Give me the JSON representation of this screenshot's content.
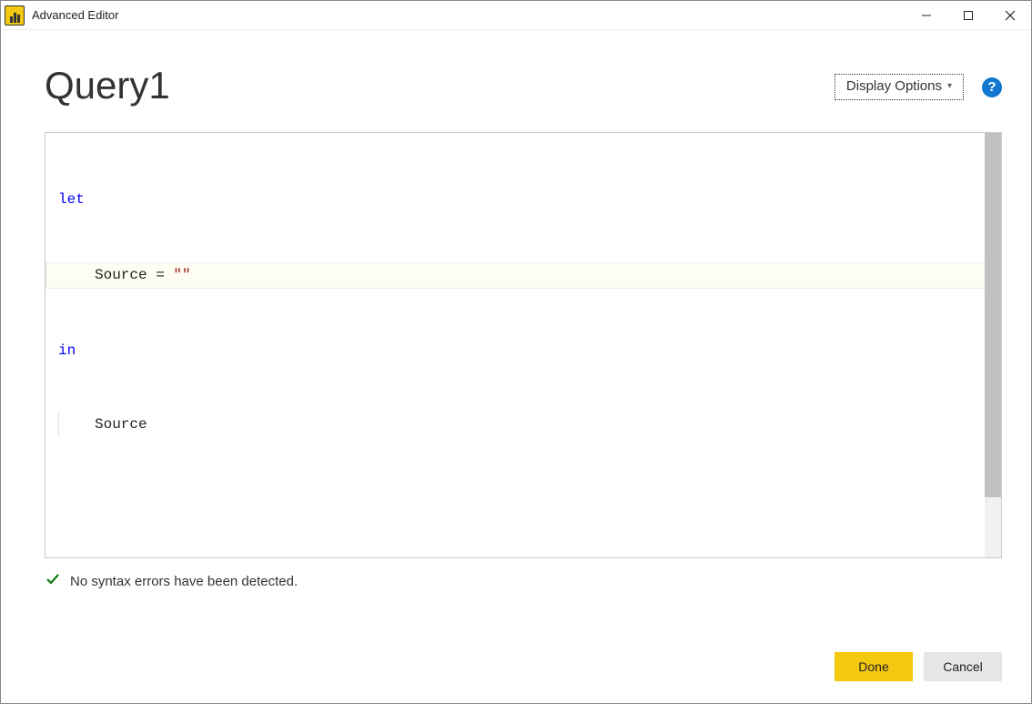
{
  "titlebar": {
    "title": "Advanced Editor"
  },
  "header": {
    "query_name": "Query1",
    "display_options_label": "Display Options"
  },
  "code": {
    "line1_keyword": "let",
    "line2_prefix": "Source = ",
    "line2_string": "\"\"",
    "line3_keyword": "in",
    "line4_text": "Source"
  },
  "status": {
    "message": "No syntax errors have been detected."
  },
  "footer": {
    "done_label": "Done",
    "cancel_label": "Cancel"
  }
}
